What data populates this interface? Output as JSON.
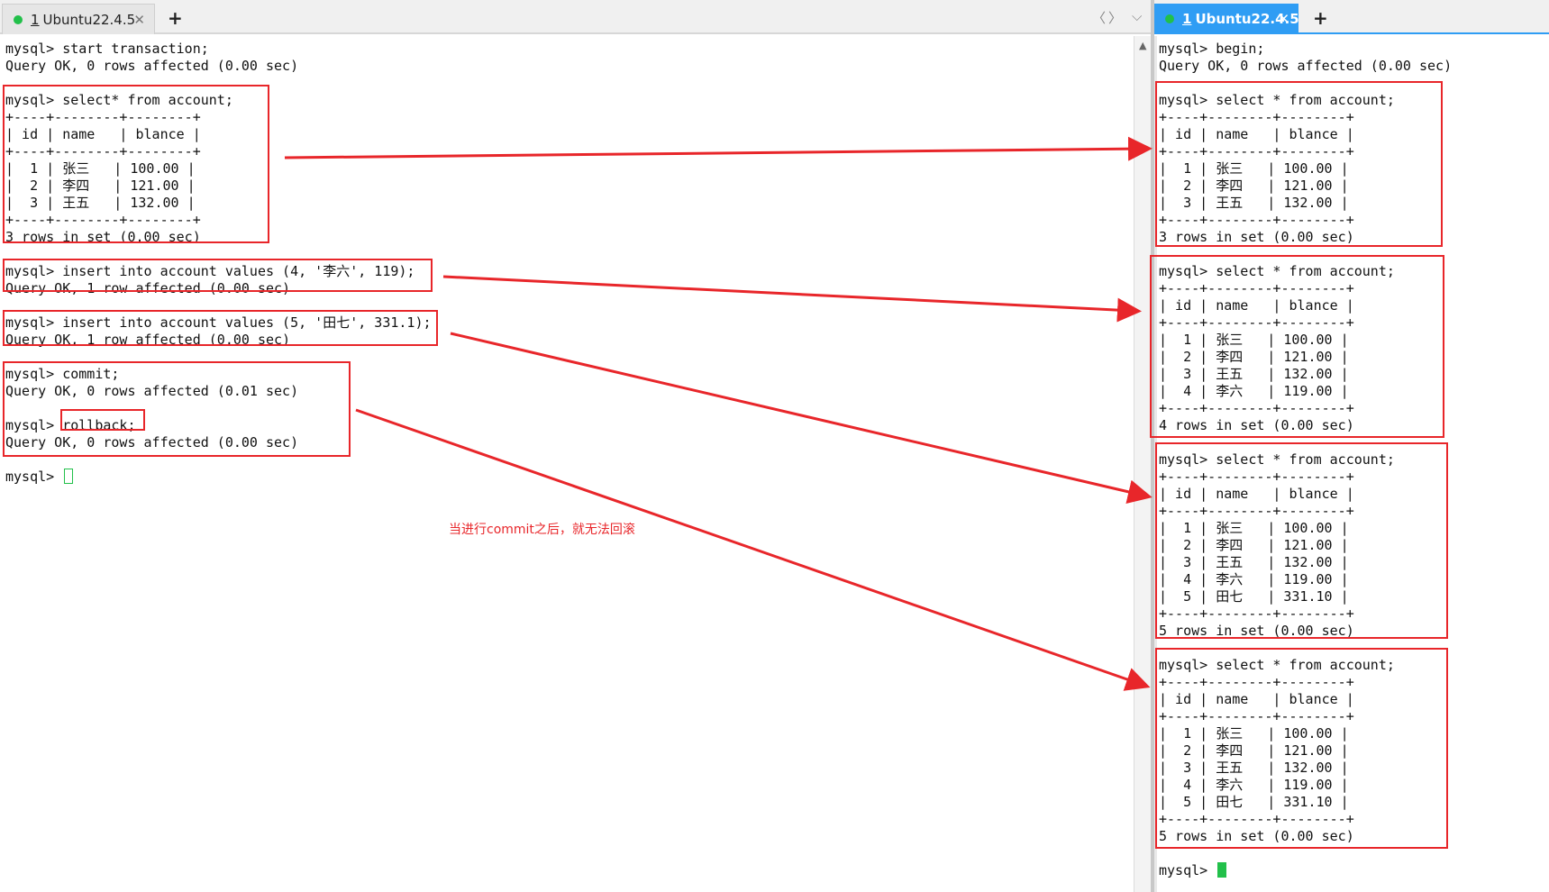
{
  "left_tab": {
    "number": "1",
    "title": "Ubuntu22.4.5",
    "close": "✕",
    "add": "+"
  },
  "right_tab": {
    "number": "1",
    "title": "Ubuntu22.4.5",
    "close": "✕",
    "add": "+"
  },
  "tab_nav": {
    "prev": "〈",
    "next": "〉",
    "menu": "⌵"
  },
  "left_terminal": {
    "lines": [
      "mysql> start transaction;",
      "Query OK, 0 rows affected (0.00 sec)",
      "",
      "mysql> select* from account;",
      "+----+--------+--------+",
      "| id | name   | blance |",
      "+----+--------+--------+",
      "|  1 | 张三   | 100.00 |",
      "|  2 | 李四   | 121.00 |",
      "|  3 | 王五   | 132.00 |",
      "+----+--------+--------+",
      "3 rows in set (0.00 sec)",
      "",
      "mysql> insert into account values (4, '李六', 119);",
      "Query OK, 1 row affected (0.00 sec)",
      "",
      "mysql> insert into account values (5, '田七', 331.1);",
      "Query OK, 1 row affected (0.00 sec)",
      "",
      "mysql> commit;",
      "Query OK, 0 rows affected (0.01 sec)",
      "",
      "mysql> rollback;",
      "Query OK, 0 rows affected (0.00 sec)",
      "",
      "mysql> "
    ]
  },
  "right_terminal": {
    "lines": [
      "mysql> begin;",
      "Query OK, 0 rows affected (0.00 sec)",
      "",
      "mysql> select * from account;",
      "+----+--------+--------+",
      "| id | name   | blance |",
      "+----+--------+--------+",
      "|  1 | 张三   | 100.00 |",
      "|  2 | 李四   | 121.00 |",
      "|  3 | 王五   | 132.00 |",
      "+----+--------+--------+",
      "3 rows in set (0.00 sec)",
      "",
      "mysql> select * from account;",
      "+----+--------+--------+",
      "| id | name   | blance |",
      "+----+--------+--------+",
      "|  1 | 张三   | 100.00 |",
      "|  2 | 李四   | 121.00 |",
      "|  3 | 王五   | 132.00 |",
      "|  4 | 李六   | 119.00 |",
      "+----+--------+--------+",
      "4 rows in set (0.00 sec)",
      "",
      "mysql> select * from account;",
      "+----+--------+--------+",
      "| id | name   | blance |",
      "+----+--------+--------+",
      "|  1 | 张三   | 100.00 |",
      "|  2 | 李四   | 121.00 |",
      "|  3 | 王五   | 132.00 |",
      "|  4 | 李六   | 119.00 |",
      "|  5 | 田七   | 331.10 |",
      "+----+--------+--------+",
      "5 rows in set (0.00 sec)",
      "",
      "mysql> select * from account;",
      "+----+--------+--------+",
      "| id | name   | blance |",
      "+----+--------+--------+",
      "|  1 | 张三   | 100.00 |",
      "|  2 | 李四   | 121.00 |",
      "|  3 | 王五   | 132.00 |",
      "|  4 | 李六   | 119.00 |",
      "|  5 | 田七   | 331.10 |",
      "+----+--------+--------+",
      "5 rows in set (0.00 sec)",
      "",
      "mysql> "
    ]
  },
  "annotation": {
    "note": "当进行commit之后，就无法回滚"
  },
  "colors": {
    "annotation": "#e8262a",
    "cursor": "#22c04a",
    "active_tab": "#2f9df4"
  }
}
